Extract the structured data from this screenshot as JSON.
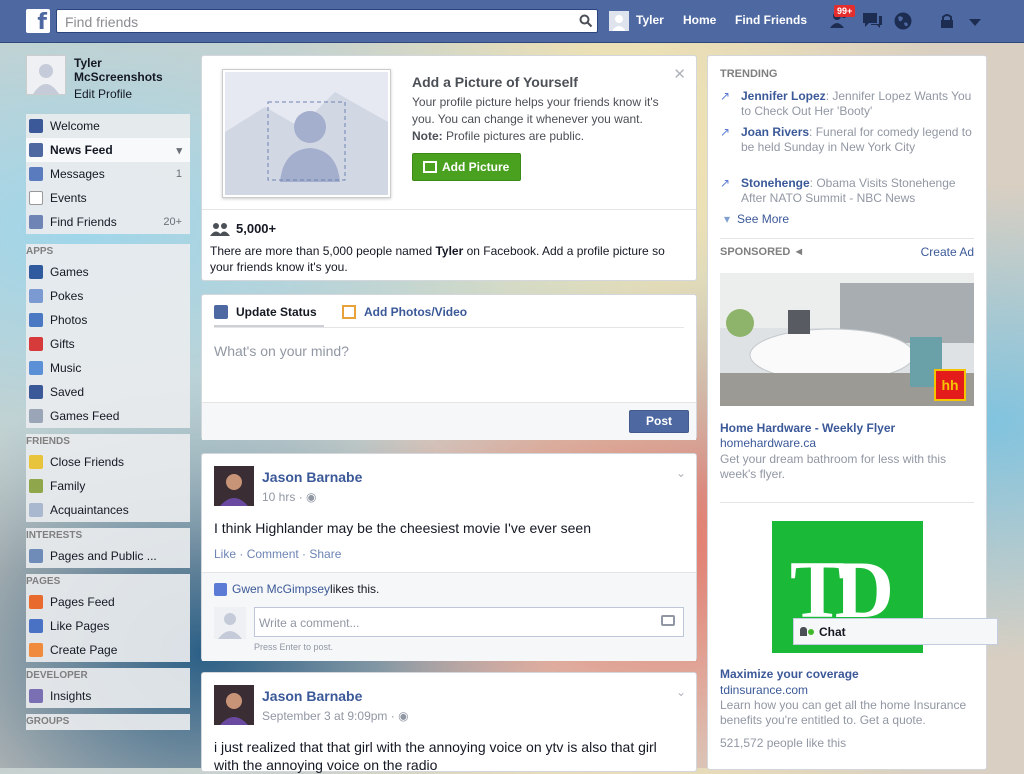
{
  "topbar": {
    "logo": "f",
    "search_placeholder": "Find friends",
    "user_name": "Tyler",
    "home": "Home",
    "find_friends": "Find Friends",
    "notification_badge": "99+",
    "icons": [
      "search-icon",
      "friend-requests-icon",
      "messages-icon",
      "globe-icon",
      "lock-icon",
      "dropdown-icon"
    ]
  },
  "profile": {
    "name_line1": "Tyler",
    "name_line2": "McScreenshots",
    "edit": "Edit Profile"
  },
  "nav": {
    "favorites": [
      {
        "label": "Welcome",
        "count": ""
      },
      {
        "label": "News Feed",
        "count": ""
      },
      {
        "label": "Messages",
        "count": "1"
      },
      {
        "label": "Events",
        "count": ""
      },
      {
        "label": "Find Friends",
        "count": "20+"
      }
    ],
    "apps_header": "APPS",
    "apps": [
      "Games",
      "Pokes",
      "Photos",
      "Gifts",
      "Music",
      "Saved",
      "Games Feed"
    ],
    "friends_header": "FRIENDS",
    "friends": [
      "Close Friends",
      "Family",
      "Acquaintances"
    ],
    "interests_header": "INTERESTS",
    "interests": [
      "Pages and Public ..."
    ],
    "pages_header": "PAGES",
    "pages": [
      "Pages Feed",
      "Like Pages",
      "Create Page"
    ],
    "developer_header": "DEVELOPER",
    "developer": [
      "Insights"
    ],
    "groups_header": "GROUPS"
  },
  "add_picture": {
    "title": "Add a Picture of Yourself",
    "body": "Your profile picture helps your friends know it's you. You can change it whenever you want.",
    "note_label": "Note:",
    "note_text": " Profile pictures are public.",
    "button": "Add Picture",
    "count": "5,000+",
    "desc_pre": "There are more than 5,000 people named ",
    "desc_name": "Tyler",
    "desc_post": " on Facebook. Add a profile picture so your friends know it's you."
  },
  "composer": {
    "tab_status": "Update Status",
    "tab_photos": "Add Photos/Video",
    "placeholder": "What's on your mind?",
    "post": "Post"
  },
  "posts": [
    {
      "author": "Jason Barnabe",
      "time": "10 hrs",
      "text": "I think Highlander may be the cheesiest movie I've ever seen",
      "actions": [
        "Like",
        "Comment",
        "Share"
      ],
      "liker": "Gwen McGimpsey",
      "likes_suffix": " likes this.",
      "comment_placeholder": "Write a comment...",
      "enter_hint": "Press Enter to post."
    },
    {
      "author": "Jason Barnabe",
      "time": "September 3 at 9:09pm",
      "text": "i just realized that that girl with the annoying voice on ytv is also that girl with the annoying voice on the radio"
    }
  ],
  "trending": {
    "header": "TRENDING",
    "items": [
      {
        "name": "Jennifer Lopez",
        "text": ": Jennifer Lopez Wants You to Check Out Her 'Booty'"
      },
      {
        "name": "Joan Rivers",
        "text": ": Funeral for comedy legend to be held Sunday in New York City"
      },
      {
        "name": "Stonehenge",
        "text": ": Obama Visits Stonehenge After NATO Summit - NBC News"
      }
    ],
    "see_more": "See More"
  },
  "sponsored": {
    "header": "SPONSORED",
    "create_ad": "Create Ad",
    "ads": [
      {
        "title": "Home Hardware - Weekly Flyer",
        "domain": "homehardware.ca",
        "text": "Get your dream bathroom for less with this week's flyer.",
        "logo": "hh"
      },
      {
        "title": "Maximize your coverage",
        "domain": "tdinsurance.com",
        "text": "Learn how you can get all the home Insurance benefits you're entitled to. Get a quote.",
        "likes": "521,572 people like this",
        "logo": "TD"
      }
    ]
  },
  "chat": {
    "label": "Chat"
  },
  "colors": {
    "bar": "#4e69a2",
    "link": "#3b5998",
    "green": "#4aa01f",
    "td_green": "#1bb938"
  }
}
